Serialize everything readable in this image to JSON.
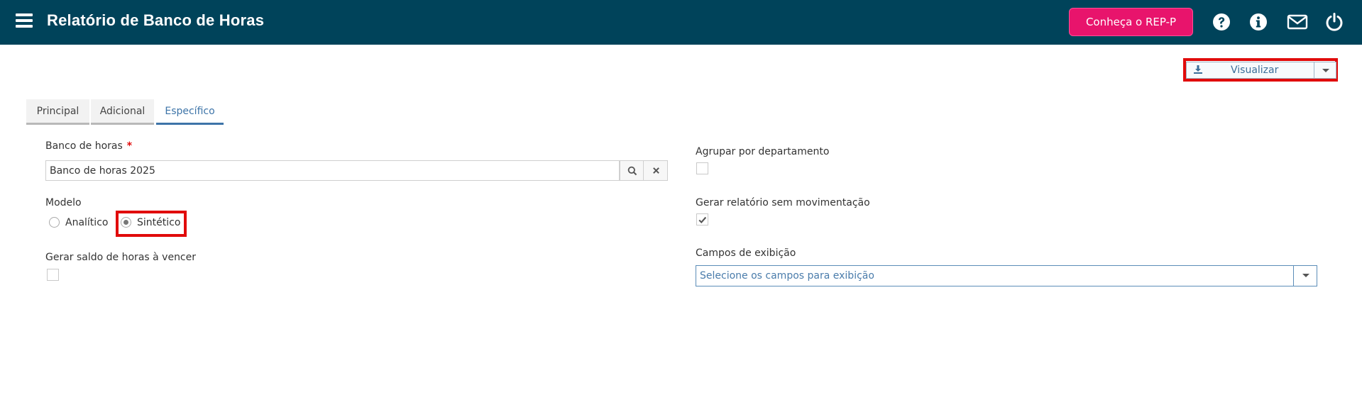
{
  "header": {
    "title": "Relatório de Banco de Horas",
    "promo_button": "Conheça o REP-P",
    "icons": [
      "menu-icon",
      "help-icon",
      "info-icon",
      "mail-icon",
      "power-icon"
    ]
  },
  "toolbar": {
    "view_label": "Visualizar"
  },
  "tabs": [
    {
      "label": "Principal"
    },
    {
      "label": "Adicional"
    },
    {
      "label": "Específico"
    }
  ],
  "form": {
    "bank_label": "Banco de horas",
    "required_mark": "*",
    "bank_value": "Banco de horas 2025",
    "model_label": "Modelo",
    "model_options": [
      "Analítico",
      "Sintético"
    ],
    "model_selected": "Sintético",
    "balance_label": "Gerar saldo de horas à vencer",
    "balance_checked": false,
    "group_label": "Agrupar por departamento",
    "group_checked": false,
    "no_movement_label": "Gerar relatório sem movimentação",
    "no_movement_checked": true,
    "fields_label": "Campos de exibição",
    "fields_placeholder": "Selecione os campos para exibição"
  },
  "colors": {
    "header_bg": "#00435a",
    "promo_bg": "#e8146c",
    "accent": "#3d74a8",
    "highlight": "#e10b0b"
  }
}
